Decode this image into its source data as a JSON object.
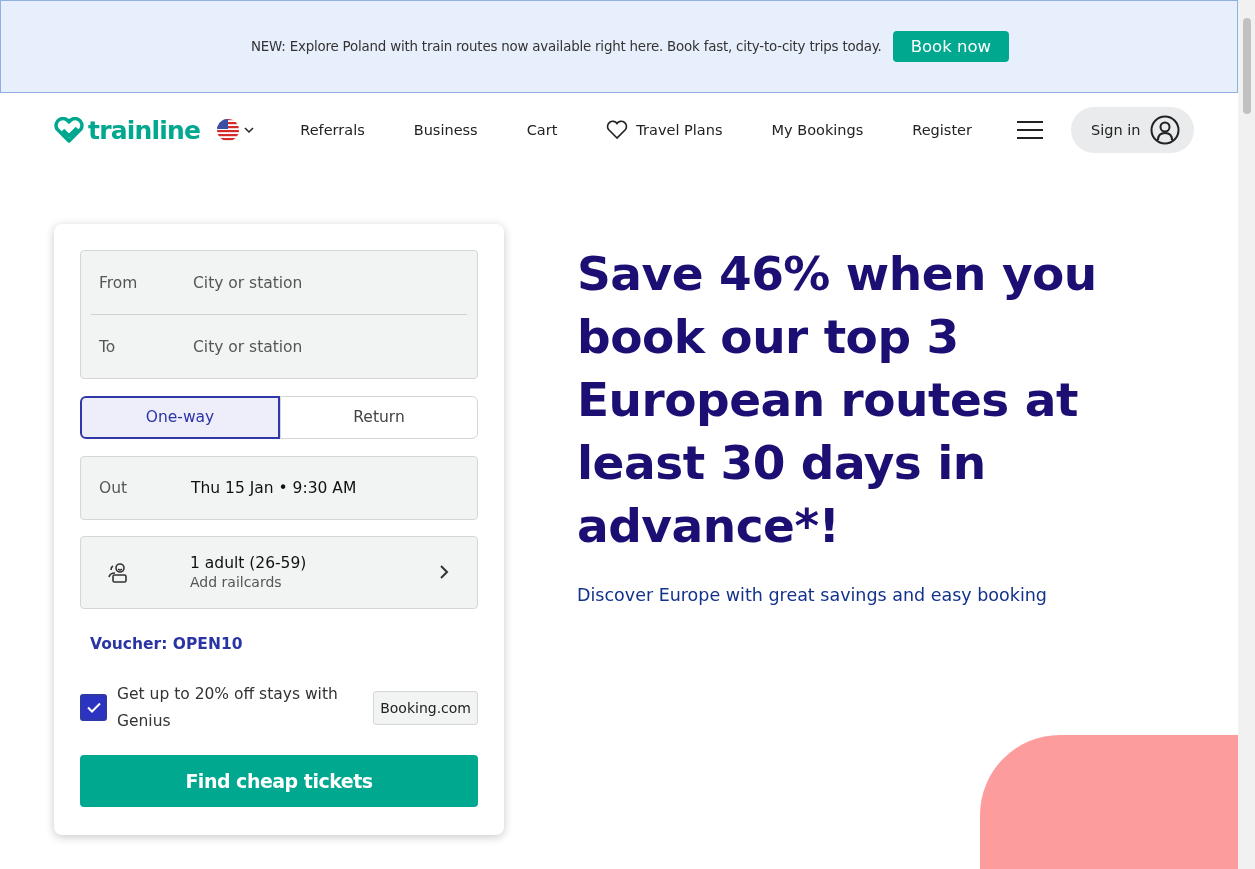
{
  "banner": {
    "text": "NEW: Explore Poland with train routes now available right here. Book fast, city-to-city trips today.",
    "button": "Book now"
  },
  "nav": {
    "logo": "trainline",
    "links": [
      {
        "label": "Referrals",
        "kind": "text"
      },
      {
        "label": "Business",
        "kind": "text"
      },
      {
        "label": "Cart",
        "kind": "text"
      },
      {
        "label": "Travel Plans",
        "kind": "saved"
      },
      {
        "label": "My Bookings",
        "kind": "text"
      },
      {
        "label": "Register",
        "kind": "text"
      }
    ],
    "sign_in": "Sign in"
  },
  "search_form": {
    "from": {
      "label": "From",
      "placeholder": "City or station"
    },
    "to": {
      "label": "To",
      "placeholder": "City or station"
    },
    "trip_types": [
      {
        "label": "One-way",
        "selected": true
      },
      {
        "label": "Return",
        "selected": false
      }
    ],
    "out": {
      "label": "Out",
      "value": "Thu 15 Jan • 9:30 AM"
    },
    "passengers": {
      "summary": "1 adult (26-59)",
      "sub": "Add railcards"
    },
    "voucher": "Voucher: OPEN10",
    "genius": {
      "text": "Get up to 20% off stays with Genius",
      "checked": true,
      "badge": "Booking.com"
    },
    "submit": "Find cheap tickets"
  },
  "hero": {
    "headline": "Save 46% when you book our top 3 European routes at least 30 days in advance*!",
    "subtitle": "Discover Europe with great savings and easy booking"
  }
}
